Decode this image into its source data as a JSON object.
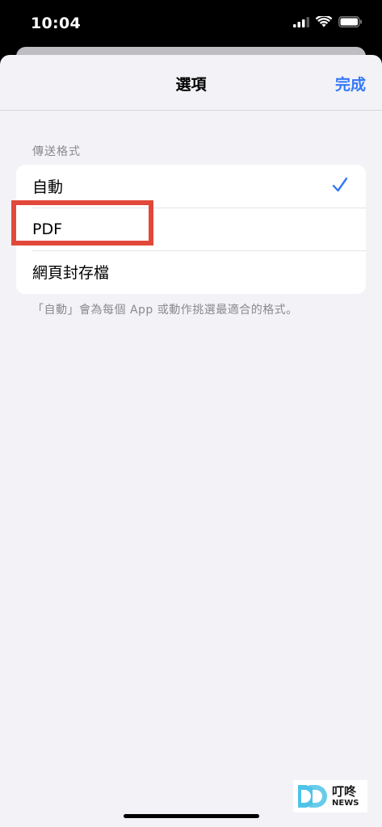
{
  "status_bar": {
    "time": "10:04",
    "icons": [
      "cellular-signal-icon",
      "wifi-icon",
      "battery-icon"
    ]
  },
  "nav": {
    "title": "選項",
    "done_label": "完成"
  },
  "section": {
    "header": "傳送格式",
    "options": [
      {
        "label": "自動",
        "selected": true
      },
      {
        "label": "PDF",
        "selected": false
      },
      {
        "label": "網頁封存檔",
        "selected": false
      }
    ],
    "footer": "「自動」會為每個 App 或動作挑選最適合的格式。"
  },
  "watermark": {
    "name_cn": "叮咚",
    "name_en": "NEWS"
  },
  "colors": {
    "accent": "#3478f6",
    "highlight": "#e2483a",
    "background": "#f2f2f7"
  }
}
